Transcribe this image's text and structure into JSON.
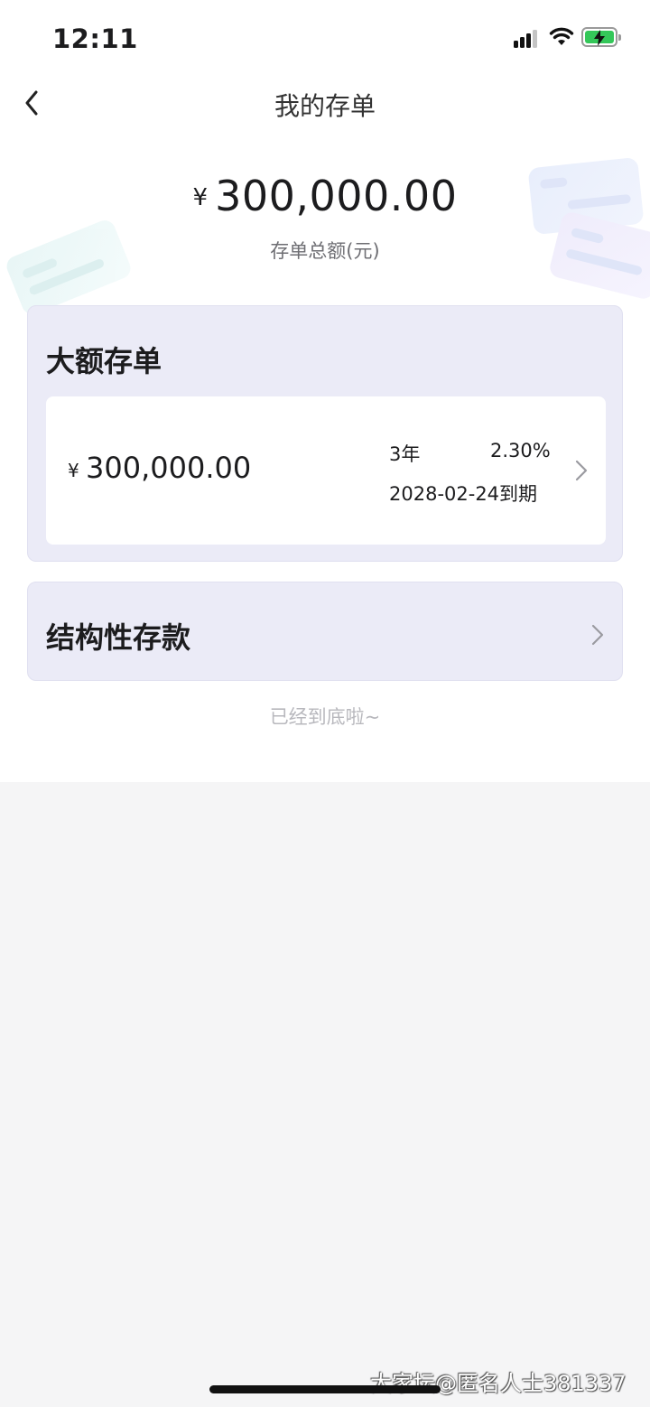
{
  "status_bar": {
    "time": "12:11",
    "battery_color": "#34c759"
  },
  "nav": {
    "title": "我的存单",
    "back_icon": "chevron-left-icon"
  },
  "summary": {
    "currency_symbol": "¥",
    "amount": "300,000.00",
    "label": "存单总额(元)"
  },
  "sections": [
    {
      "title": "大额存单",
      "items": [
        {
          "currency_symbol": "¥",
          "amount": "300,000.00",
          "term": "3年",
          "rate": "2.30%",
          "maturity": "2028-02-24到期"
        }
      ]
    },
    {
      "title": "结构性存款"
    }
  ],
  "footer": {
    "end_text": "已经到底啦~"
  },
  "watermark": "大家坛@匿名人士381337",
  "colors": {
    "section_bg": "#ebebf7",
    "page_bg": "#f5f5f6"
  }
}
